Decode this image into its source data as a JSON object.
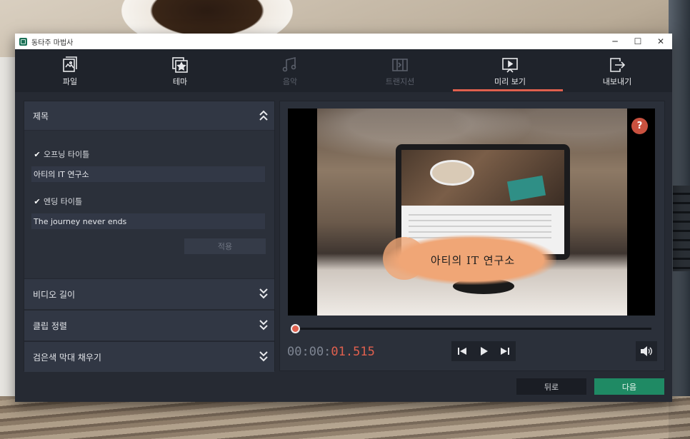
{
  "window": {
    "title": "동타주 마법사"
  },
  "window_controls": {
    "minimize": "─",
    "maximize": "☐",
    "close": "✕"
  },
  "tabs": [
    {
      "label": "파일",
      "icon": "film-file-icon",
      "enabled": true
    },
    {
      "label": "테마",
      "icon": "theme-star-icon",
      "enabled": true
    },
    {
      "label": "음악",
      "icon": "music-note-icon",
      "enabled": false
    },
    {
      "label": "트랜지션",
      "icon": "transition-icon",
      "enabled": false
    },
    {
      "label": "미리 보기",
      "icon": "preview-play-icon",
      "enabled": true,
      "active": true
    },
    {
      "label": "내보내기",
      "icon": "export-icon",
      "enabled": true
    }
  ],
  "title_section": {
    "header": "제목",
    "opening_checkbox_label": "오프닝 타이틀",
    "opening_checked": true,
    "opening_value": "아티의 IT 연구소",
    "ending_checkbox_label": "엔딩 타이틀",
    "ending_checked": true,
    "ending_value": "The journey never ends",
    "apply_label": "적용"
  },
  "collapsed_sections": [
    {
      "label": "비디오 길이"
    },
    {
      "label": "클립 정렬"
    },
    {
      "label": "검은색 막대 채우기"
    }
  ],
  "preview": {
    "overlay_title": "아티의 IT 연구소",
    "help_label": "?",
    "timecode_prefix": "00:00:",
    "timecode_value": "01.515",
    "progress": 0.0
  },
  "footer": {
    "back_label": "뒤로",
    "next_label": "다음"
  },
  "colors": {
    "accent": "#e0604e",
    "next_button": "#1f8a64",
    "toolbar_bg": "#1f232b",
    "panel_bg": "#2b303a"
  }
}
